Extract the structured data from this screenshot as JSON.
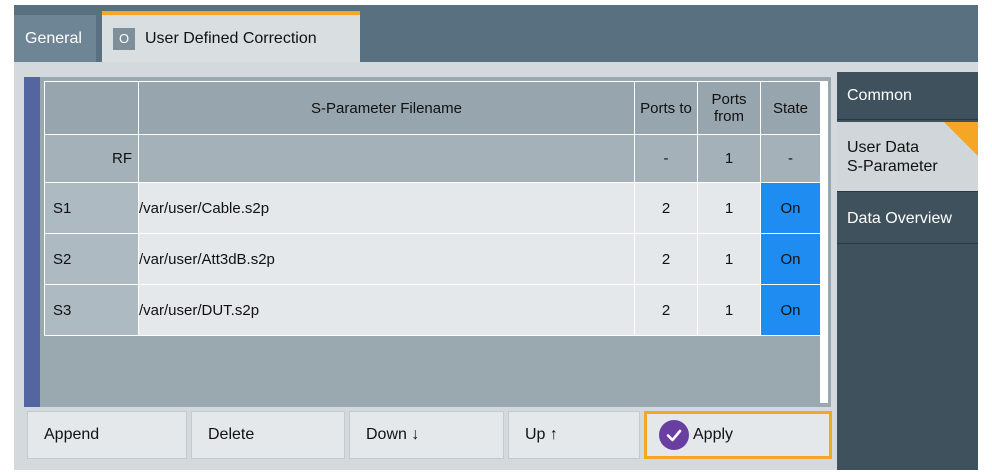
{
  "tabs": [
    {
      "label": "General"
    },
    {
      "badge": "O",
      "label": "User Defined Correction"
    }
  ],
  "table": {
    "headers": {
      "filename": "S-Parameter Filename",
      "ports_to": "Ports to",
      "ports_from": "Ports from",
      "state": "State"
    },
    "rf_row": {
      "label": "RF",
      "filename": "",
      "ports_to": "-",
      "ports_from": "1",
      "state": "-"
    },
    "rows": [
      {
        "id": "S1",
        "filename": "/var/user/Cable.s2p",
        "ports_to": "2",
        "ports_from": "1",
        "state": "On"
      },
      {
        "id": "S2",
        "filename": "/var/user/Att3dB.s2p",
        "ports_to": "2",
        "ports_from": "1",
        "state": "On"
      },
      {
        "id": "S3",
        "filename": "/var/user/DUT.s2p",
        "ports_to": "2",
        "ports_from": "1",
        "state": "On"
      }
    ]
  },
  "buttons": {
    "append": "Append",
    "delete": "Delete",
    "down": "Down ↓",
    "up": "Up ↑",
    "apply": "Apply"
  },
  "sidenav": {
    "common": "Common",
    "user_data_line1": "User Data",
    "user_data_line2": "S-Parameter",
    "data_overview": "Data Overview"
  },
  "colors": {
    "accent": "#f5a623",
    "state_on": "#1e8cf0",
    "apply_check": "#6a3ea0",
    "nav_bg": "#3e515c"
  },
  "icons": {
    "apply": "checkmark-circle-icon"
  }
}
